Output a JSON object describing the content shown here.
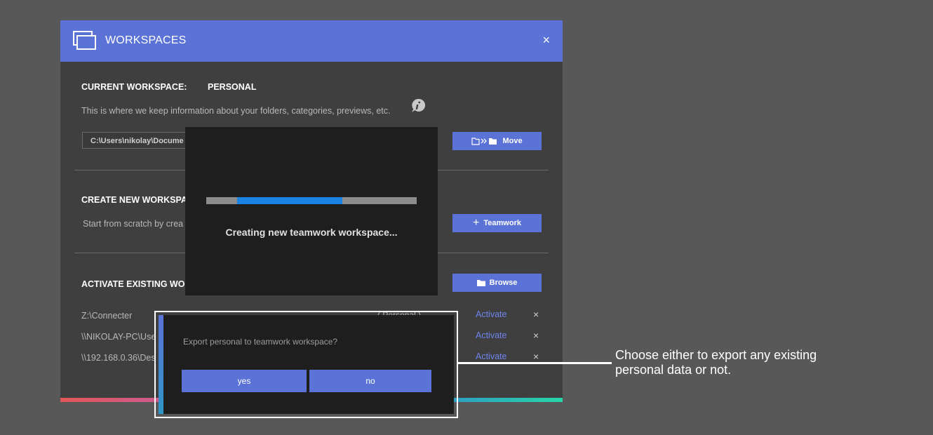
{
  "dialog": {
    "title": "WORKSPACES",
    "close_glyph": "×",
    "colors": {
      "titlebar": "#5b72d6",
      "body": "#3f3f3f",
      "link": "#6e85ee",
      "progress_fill": "#1a82e2"
    }
  },
  "current": {
    "label": "CURRENT WORKSPACE:",
    "value": "PERSONAL",
    "description": "This is where we keep information about your folders, categories, previews, etc.",
    "info_icon": "info-bubble-icon",
    "path": "C:\\Users\\nikolay\\Docume",
    "move_label": "Move"
  },
  "create": {
    "label": "CREATE NEW WORKSPAC",
    "description": "Start from scratch by crea",
    "teamwork_label": "Teamwork"
  },
  "activate": {
    "label": "ACTIVATE EXISTING WOR",
    "browse_label": "Browse",
    "rows": [
      {
        "path": "Z:\\Connecter",
        "tag": "( Personal )",
        "action": "Activate",
        "remove": "×"
      },
      {
        "path": "\\\\NIKOLAY-PC\\Use",
        "tag": "",
        "action": "Activate",
        "remove": "×"
      },
      {
        "path": "\\\\192.168.0.36\\Des",
        "tag": "",
        "action": "Activate",
        "remove": "×"
      }
    ]
  },
  "progress": {
    "text": "Creating new teamwork workspace...",
    "fraction": 0.5
  },
  "confirm": {
    "question": "Export personal to teamwork workspace?",
    "yes_label": "yes",
    "no_label": "no"
  },
  "callout": {
    "text": "Choose either to export any existing personal data or not."
  }
}
